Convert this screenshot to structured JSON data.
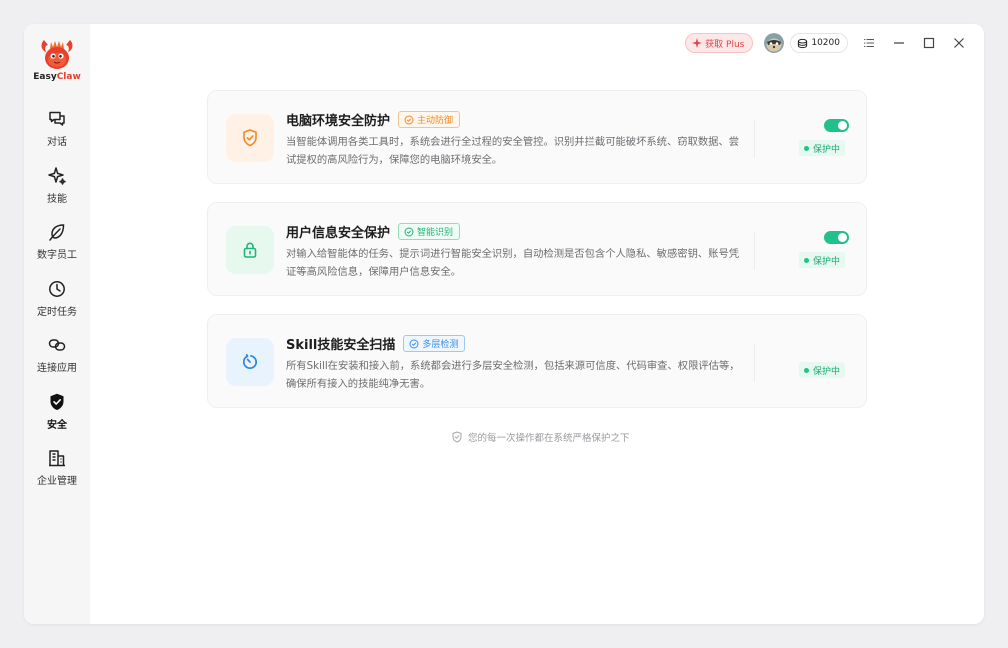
{
  "app": {
    "logo_word1": "Easy",
    "logo_word2": "Claw",
    "brand_color": "#e8402c"
  },
  "sidebar": {
    "items": [
      {
        "label": "对话",
        "icon": "chat-icon"
      },
      {
        "label": "技能",
        "icon": "sparkle-icon"
      },
      {
        "label": "数字员工",
        "icon": "leaf-icon"
      },
      {
        "label": "定时任务",
        "icon": "clock-icon"
      },
      {
        "label": "连接应用",
        "icon": "link-icon"
      },
      {
        "label": "安全",
        "icon": "shield-icon",
        "active": true
      },
      {
        "label": "企业管理",
        "icon": "building-icon"
      }
    ]
  },
  "topbar": {
    "plus_label": "获取 Plus",
    "coins": "10200"
  },
  "cards": [
    {
      "title": "电脑环境安全防护",
      "tag": "主动防御",
      "tag_color": "#f08a24",
      "desc": "当智能体调用各类工具时，系统会进行全过程的安全管控。识别并拦截可能破坏系统、窃取数据、尝试提权的高风险行为，保障您的电脑环境安全。",
      "status": "保护中",
      "toggle_on": true,
      "icon": "shield-check-icon"
    },
    {
      "title": "用户信息安全保护",
      "tag": "智能识别",
      "tag_color": "#1fb676",
      "desc": "对输入给智能体的任务、提示词进行智能安全识别，自动检测是否包含个人隐私、敏感密钥、账号凭证等高风险信息，保障用户信息安全。",
      "status": "保护中",
      "toggle_on": true,
      "icon": "lock-icon"
    },
    {
      "title": "Skill技能安全扫描",
      "tag": "多层检测",
      "tag_color": "#3a8ee6",
      "desc": "所有Skill在安装和接入前，系统都会进行多层安全检测，包括来源可信度、代码审查、权限评估等，确保所有接入的技能纯净无害。",
      "status": "保护中",
      "toggle_on": false,
      "icon": "scan-icon"
    }
  ],
  "footer_note": "您的每一次操作都在系统严格保护之下"
}
